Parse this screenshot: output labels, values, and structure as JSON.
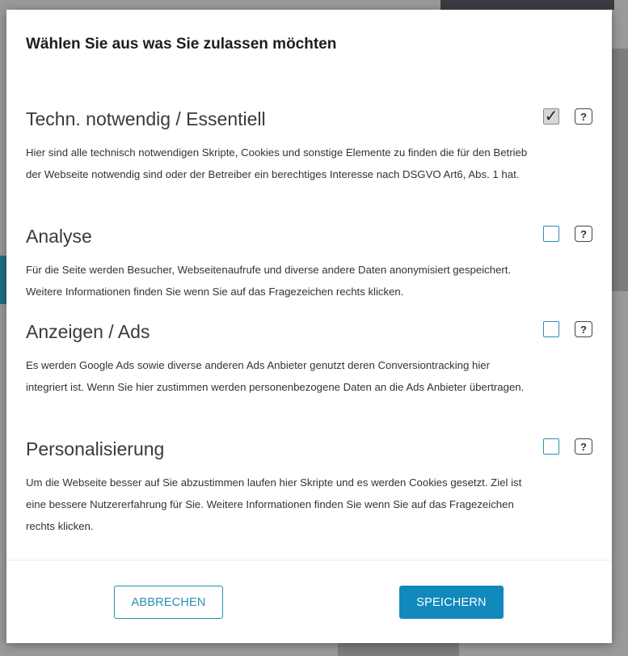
{
  "dialog": {
    "title": "Wählen Sie aus was Sie zulassen möchten",
    "sections": [
      {
        "heading": "Techn. notwendig / Essentiell",
        "description": "Hier sind alle technisch notwendigen Skripte, Cookies und sonstige Elemente zu finden die für den Betrieb der Webseite notwendig sind oder der Betreiber ein berechtiges Interesse nach DSGVO Art6, Abs. 1 hat.",
        "checked": true,
        "checkmark": "✓",
        "help_label": "?"
      },
      {
        "heading": "Analyse",
        "description": "Für die Seite werden Besucher, Webseitenaufrufe und diverse andere Daten anonymisiert gespeichert. Weitere Informationen finden Sie wenn Sie auf das Fragezeichen rechts klicken.",
        "checked": false,
        "help_label": "?"
      },
      {
        "heading": "Anzeigen / Ads",
        "description": "Es werden Google Ads sowie diverse anderen Ads Anbieter genutzt deren Conversiontracking hier integriert ist. Wenn Sie hier zustimmen werden personenbezogene Daten an die Ads Anbieter übertragen.",
        "checked": false,
        "help_label": "?"
      },
      {
        "heading": "Personalisierung",
        "description": "Um die Webseite besser auf Sie abzustimmen laufen hier Skripte und es werden Cookies gesetzt. Ziel ist eine bessere Nutzererfahrung für Sie. Weitere Informationen finden Sie wenn Sie auf das Fragezeichen rechts klicken.",
        "checked": false,
        "help_label": "?"
      }
    ],
    "cancel_label": "ABBRECHEN",
    "save_label": "SPEICHERN"
  },
  "colors": {
    "accent": "#1189bd",
    "checkbox_border": "#2a8fb5",
    "overlay": "#8f8f8f"
  }
}
